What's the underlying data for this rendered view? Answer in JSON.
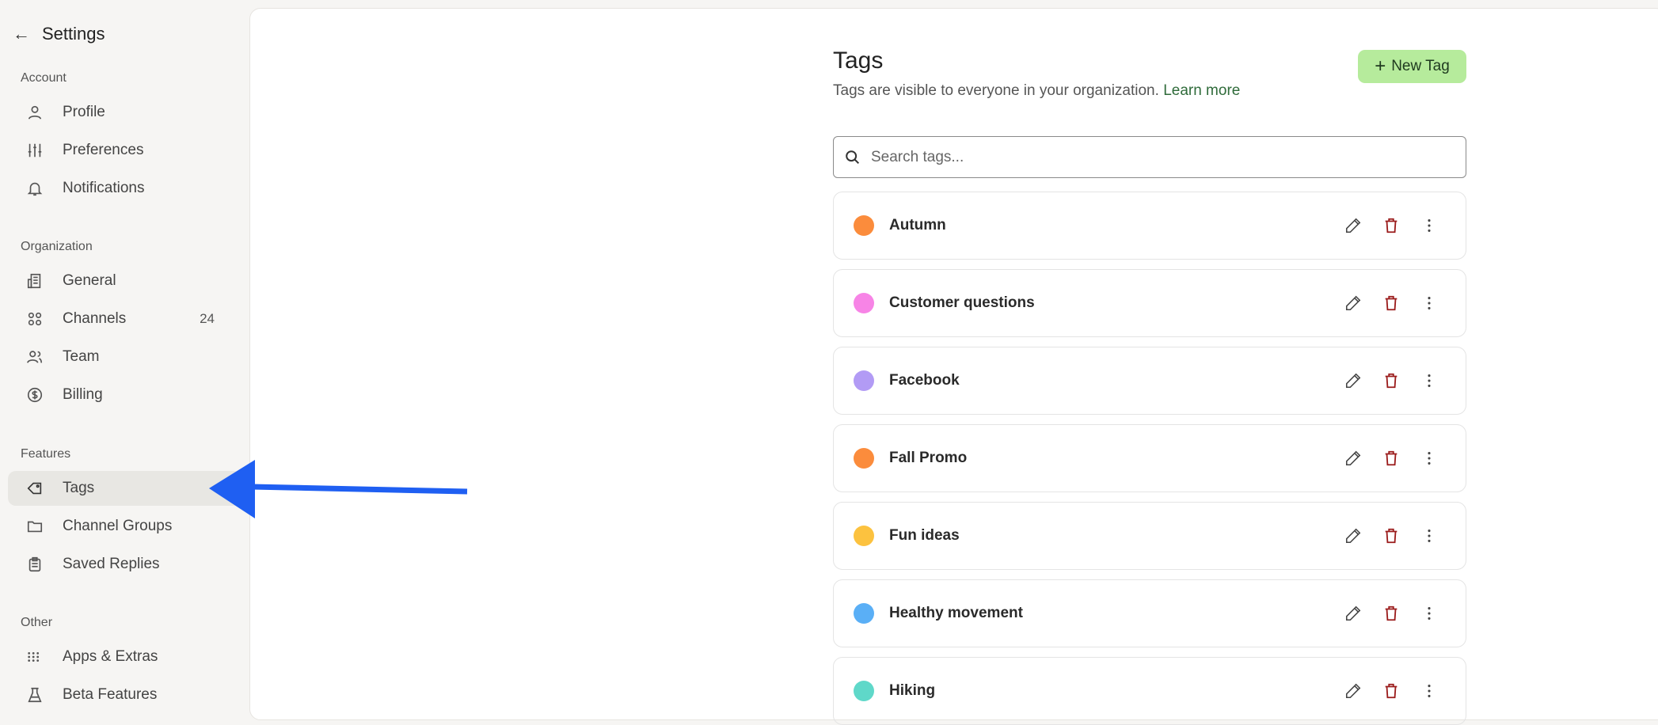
{
  "sidebar": {
    "back_label": "Settings",
    "sections": [
      {
        "label": "Account",
        "items": [
          {
            "label": "Profile",
            "icon": "user-icon"
          },
          {
            "label": "Preferences",
            "icon": "sliders-icon"
          },
          {
            "label": "Notifications",
            "icon": "bell-icon"
          }
        ]
      },
      {
        "label": "Organization",
        "items": [
          {
            "label": "General",
            "icon": "building-icon"
          },
          {
            "label": "Channels",
            "icon": "grid-circles-icon",
            "badge": "24"
          },
          {
            "label": "Team",
            "icon": "users-icon"
          },
          {
            "label": "Billing",
            "icon": "dollar-circle-icon"
          }
        ]
      },
      {
        "label": "Features",
        "items": [
          {
            "label": "Tags",
            "icon": "tag-icon",
            "active": true
          },
          {
            "label": "Channel Groups",
            "icon": "folder-icon"
          },
          {
            "label": "Saved Replies",
            "icon": "clipboard-icon"
          }
        ]
      },
      {
        "label": "Other",
        "items": [
          {
            "label": "Apps & Extras",
            "icon": "dots-grid-icon"
          },
          {
            "label": "Beta Features",
            "icon": "flask-icon"
          }
        ]
      }
    ]
  },
  "page": {
    "title": "Tags",
    "subtitle": "Tags are visible to everyone in your organization.",
    "learn_more": "Learn more",
    "new_tag_label": "New Tag",
    "search_placeholder": "Search tags..."
  },
  "tags": [
    {
      "name": "Autumn",
      "color": "#fb8c3c"
    },
    {
      "name": "Customer questions",
      "color": "#f784e6"
    },
    {
      "name": "Facebook",
      "color": "#b29bf5"
    },
    {
      "name": "Fall Promo",
      "color": "#fb8c3c"
    },
    {
      "name": "Fun ideas",
      "color": "#fcc23f"
    },
    {
      "name": "Healthy movement",
      "color": "#5aaff6"
    },
    {
      "name": "Hiking",
      "color": "#5fd8c9"
    }
  ],
  "colors": {
    "accent_button": "#b6eb9c",
    "link": "#2f6b3a",
    "delete": "#9b1c1c",
    "annotation_arrow": "#1f5ff2"
  }
}
